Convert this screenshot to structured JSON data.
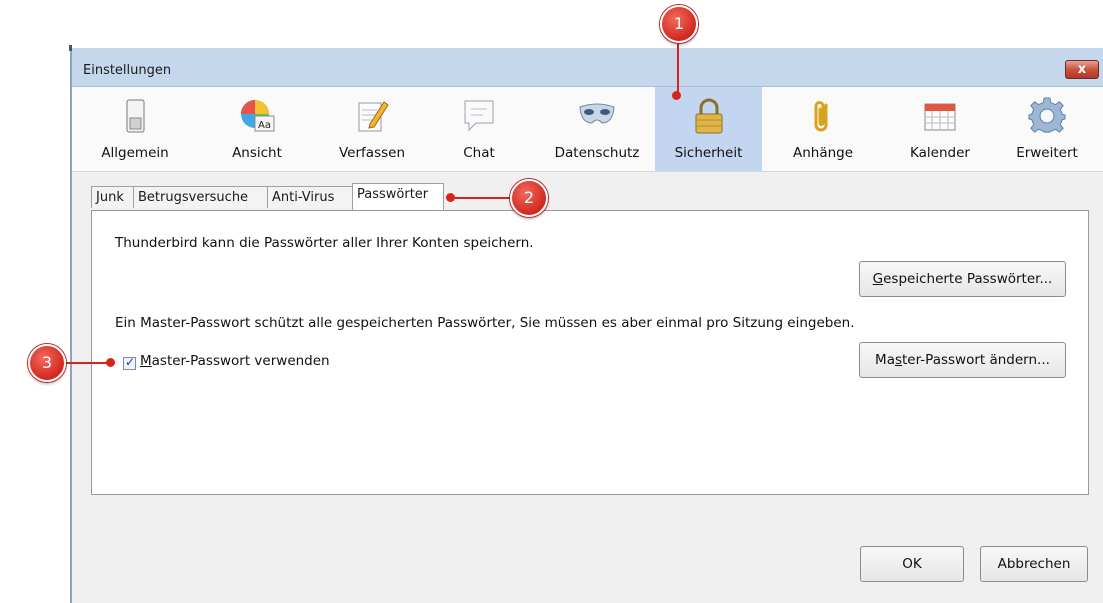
{
  "window": {
    "title": "Einstellungen",
    "close_label": "x"
  },
  "toolbar": {
    "items": [
      {
        "label": "Allgemein",
        "icon": "switch-icon"
      },
      {
        "label": "Ansicht",
        "icon": "color-wheel-icon"
      },
      {
        "label": "Verfassen",
        "icon": "compose-pencil-icon"
      },
      {
        "label": "Chat",
        "icon": "chat-bubble-icon"
      },
      {
        "label": "Datenschutz",
        "icon": "mask-icon"
      },
      {
        "label": "Sicherheit",
        "icon": "padlock-icon",
        "active": true
      },
      {
        "label": "Anhänge",
        "icon": "paperclip-icon"
      },
      {
        "label": "Kalender",
        "icon": "calendar-icon"
      },
      {
        "label": "Erweitert",
        "icon": "gear-icon"
      }
    ],
    "icon_sub": "Aa"
  },
  "tabs": [
    {
      "label": "Junk"
    },
    {
      "label": "Betrugsversuche"
    },
    {
      "label": "Anti-Virus"
    },
    {
      "label": "Passwörter",
      "active": true
    }
  ],
  "panel": {
    "intro": "Thunderbird kann die Passwörter aller Ihrer Konten speichern.",
    "saved_btn": {
      "accel": "G",
      "rest": "espeicherte Passwörter..."
    },
    "master_text": "Ein Master-Passwort schützt alle gespeicherten Passwörter, Sie müssen es aber einmal pro Sitzung eingeben.",
    "use_master": {
      "accel": "M",
      "rest": "aster-Passwort verwenden",
      "checked": true
    },
    "change_master": {
      "pre": "Ma",
      "accel": "s",
      "rest": "ter-Passwort ändern..."
    }
  },
  "footer": {
    "ok": "OK",
    "cancel": "Abbrechen"
  },
  "annotations": [
    "1",
    "2",
    "3"
  ],
  "colors": {
    "accent_active": "#c3d6ef",
    "annotation": "#d6251d"
  }
}
